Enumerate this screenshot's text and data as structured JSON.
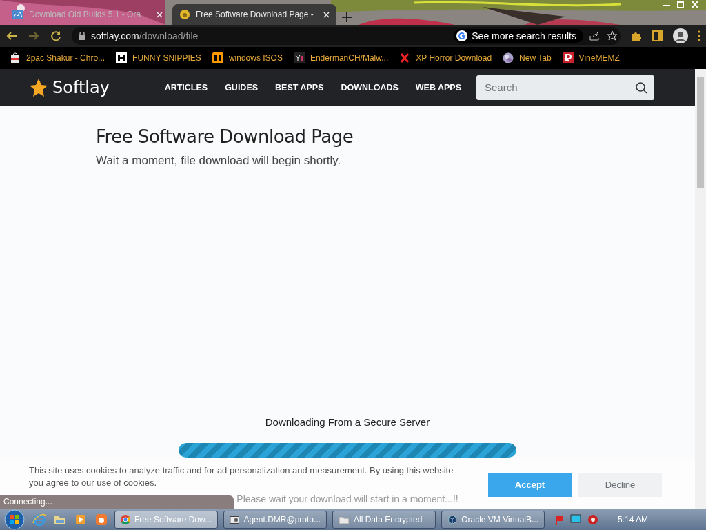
{
  "browser": {
    "tabs": [
      {
        "title": "Download Old Builds 5.1 - Ora",
        "selected": false
      },
      {
        "title": "Free Software Download Page - ",
        "selected": true
      }
    ],
    "address": {
      "domain": "softlay.com",
      "path": "/download/file"
    },
    "search_chip": "See more search results",
    "bookmarks": [
      {
        "label": "2pac Shakur - Chro...",
        "kind": "store"
      },
      {
        "label": "FUNNY SNIPPIES",
        "kind": "h"
      },
      {
        "label": "windows ISOS",
        "kind": "ph"
      },
      {
        "label": "EndermanCH/Malw...",
        "kind": "yp"
      },
      {
        "label": "XP Horror Download",
        "kind": "x"
      },
      {
        "label": "New Tab",
        "kind": "globe"
      },
      {
        "label": "VineMEMZ",
        "kind": "r"
      }
    ],
    "status": "Connecting..."
  },
  "site": {
    "logo": "Softlay",
    "nav": [
      "ARTICLES",
      "GUIDES",
      "BEST APPS",
      "DOWNLOADS",
      "WEB APPS"
    ],
    "search": {
      "placeholder": "Search"
    }
  },
  "page": {
    "title": "Free Software Download Page",
    "subtitle": "Wait a moment, file download will begin shortly.",
    "download": {
      "heading": "Downloading From a Secure Server",
      "level": 1,
      "note": "Please wait your download will start in a moment...!!"
    }
  },
  "cookie_banner": {
    "text": "This site uses cookies to analyze traffic and for ad personalization and measurement. By using this website you agree to our use of cookies.",
    "buttons": [
      {
        "label": "Accept",
        "kind": "primary"
      },
      {
        "label": "Decline",
        "kind": "secondary"
      }
    ]
  },
  "taskbar": {
    "tasks": [
      {
        "label": "Free Software Dow...",
        "kind": "chrome",
        "selected": true
      },
      {
        "label": "Agent.DMR@proto...",
        "kind": "window",
        "selected": false
      },
      {
        "label": "All Data Encrypted",
        "kind": "folder",
        "selected": false
      },
      {
        "label": "Oracle VM VirtualB...",
        "kind": "cube",
        "selected": false
      }
    ],
    "clock": "5:14 AM"
  }
}
